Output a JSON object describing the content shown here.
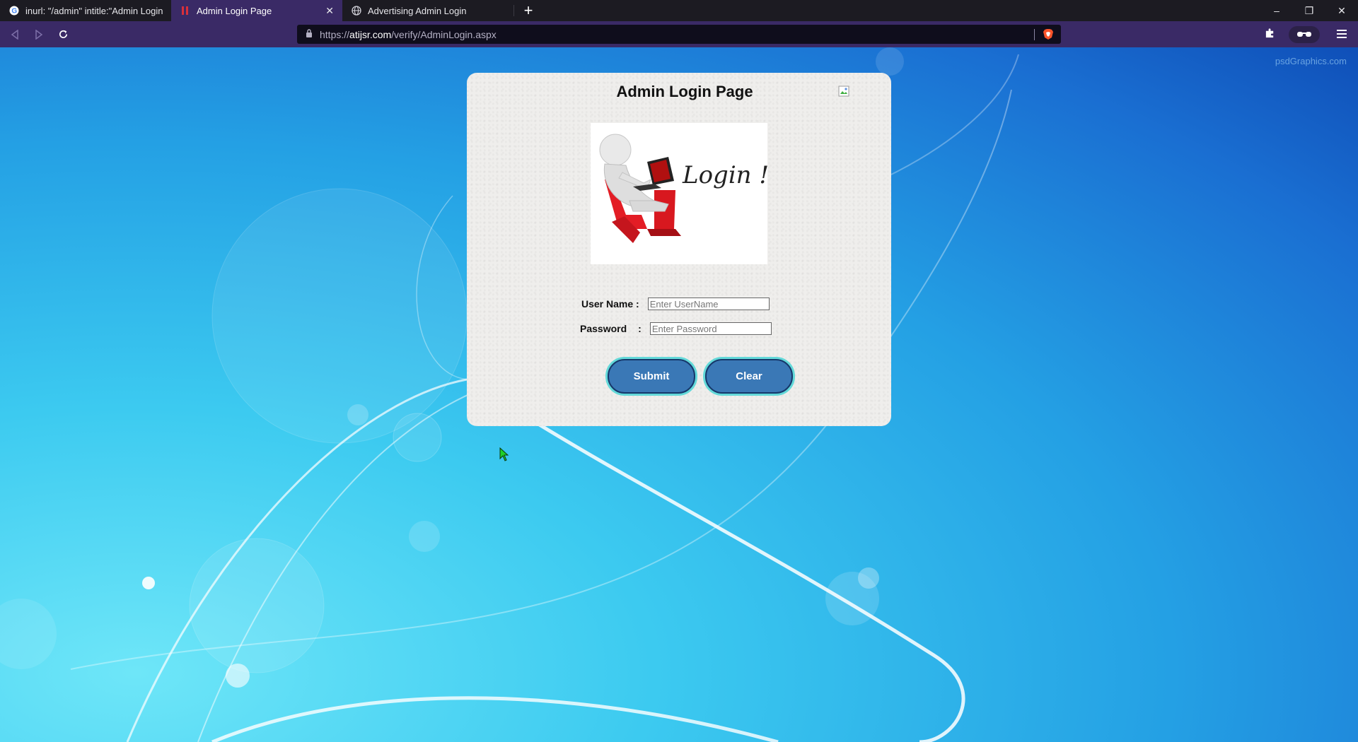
{
  "browser": {
    "tabs": [
      {
        "title": "inurl: \"/admin\" intitle:\"Admin Login\" -",
        "favicon": "google-icon",
        "active": false
      },
      {
        "title": "Admin Login Page",
        "favicon": "page-icon",
        "active": true,
        "close": "✕"
      },
      {
        "title": "Advertising Admin Login",
        "favicon": "globe-icon",
        "active": false
      }
    ],
    "new_tab": "+",
    "window_controls": {
      "minimize": "–",
      "restore": "❐",
      "close": "✕"
    },
    "url": {
      "scheme": "https://",
      "host": "atijsr.com",
      "path": "/verify/AdminLogin.aspx"
    }
  },
  "page": {
    "watermark": "psdGraphics.com",
    "title": "Admin Login Page",
    "hero_text": "Login !",
    "form": {
      "username_label": "User Name :",
      "username_placeholder": "Enter UserName",
      "password_label": "Password",
      "password_colon": ":",
      "password_placeholder": "Enter Password"
    },
    "buttons": {
      "submit": "Submit",
      "clear": "Clear"
    }
  },
  "colors": {
    "accent": "#3a2a66",
    "button_fill": "#3a78b6",
    "button_glow": "#63d9d9"
  }
}
